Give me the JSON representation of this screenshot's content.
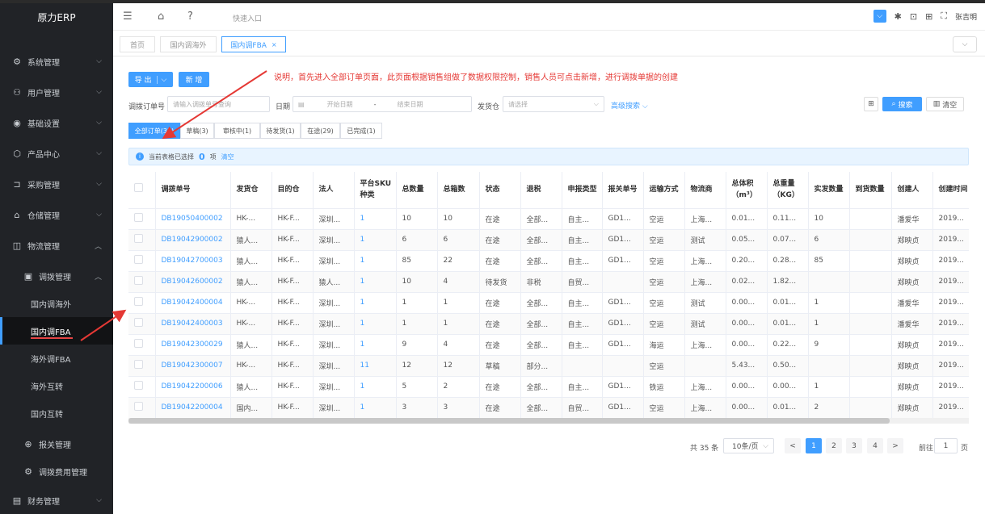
{
  "app": {
    "logo": "原力ERP"
  },
  "sidebar": {
    "items": [
      {
        "label": "系统管理",
        "icon": "gear-icon"
      },
      {
        "label": "用户管理",
        "icon": "user-icon"
      },
      {
        "label": "基础设置",
        "icon": "settings-icon"
      },
      {
        "label": "产品中心",
        "icon": "box-icon"
      },
      {
        "label": "采购管理",
        "icon": "cart-icon"
      },
      {
        "label": "仓储管理",
        "icon": "warehouse-icon"
      },
      {
        "label": "物流管理",
        "icon": "truck-icon"
      },
      {
        "label": "调拨管理",
        "icon": "transfer-icon"
      },
      {
        "label": "国内调海外"
      },
      {
        "label": "国内调FBA"
      },
      {
        "label": "海外调FBA"
      },
      {
        "label": "海外互转"
      },
      {
        "label": "国内互转"
      },
      {
        "label": "报关管理",
        "icon": "customs-icon"
      },
      {
        "label": "调拨费用管理",
        "icon": "fee-icon"
      },
      {
        "label": "财务管理",
        "icon": "finance-icon"
      }
    ]
  },
  "header": {
    "quick_entry": "快速入口",
    "user": "张吉明"
  },
  "tabs": [
    {
      "label": "首页"
    },
    {
      "label": "国内调海外"
    },
    {
      "label": "国内调FBA",
      "close": "×"
    }
  ],
  "toolbar": {
    "export": "导 出",
    "export_arrow": "⌵",
    "new": "新 增"
  },
  "note": "说明，首先进入全部订单页面，此页面根据销售组做了数据权限控制，销售人员可点击新增，进行调拨单据的创建",
  "filters": {
    "order_label": "调拨订单号",
    "order_placeholder": "请输入调拨单号查询",
    "date_label": "日期",
    "date_start": "开始日期",
    "date_sep": "-",
    "date_end": "结束日期",
    "warehouse_label": "发货仓",
    "warehouse_placeholder": "请选择",
    "advanced": "高级搜索",
    "search": "搜索",
    "clear": "清空"
  },
  "status_tabs": [
    {
      "label": "全部订单(35)"
    },
    {
      "label": "草稿(3)"
    },
    {
      "label": "审核中(1)"
    },
    {
      "label": "待发货(1)"
    },
    {
      "label": "在途(29)"
    },
    {
      "label": "已完成(1)"
    }
  ],
  "selection": {
    "prefix": "当前表格已选择",
    "count": "0",
    "unit": "项",
    "clear": "清空"
  },
  "table": {
    "columns": [
      "调拨单号",
      "发货仓",
      "目的仓",
      "法人",
      "平台SKU种类",
      "总数量",
      "总箱数",
      "状态",
      "退税",
      "申报类型",
      "报关单号",
      "运输方式",
      "物流商",
      "总体积（m³）",
      "总重量（KG）",
      "实发数量",
      "到货数量",
      "创建人",
      "创建时间"
    ],
    "rows": [
      [
        "DB19050400002",
        "HK-...",
        "HK-F...",
        "深圳...",
        "1",
        "10",
        "10",
        "在途",
        "全部...",
        "自主...",
        "GD1...",
        "空运",
        "上海...",
        "0.01...",
        "0.11...",
        "10",
        "",
        "潘爱华",
        "2019..."
      ],
      [
        "DB19042900002",
        "猿人...",
        "HK-F...",
        "深圳...",
        "1",
        "6",
        "6",
        "在途",
        "全部...",
        "自主...",
        "GD1...",
        "空运",
        "测试",
        "0.05...",
        "0.07...",
        "6",
        "",
        "郑映贞",
        "2019..."
      ],
      [
        "DB19042700003",
        "猿人...",
        "HK-F...",
        "深圳...",
        "1",
        "85",
        "22",
        "在途",
        "全部...",
        "自主...",
        "GD1...",
        "空运",
        "上海...",
        "0.20...",
        "0.28...",
        "85",
        "",
        "郑映贞",
        "2019..."
      ],
      [
        "DB19042600002",
        "猿人...",
        "HK-F...",
        "猿人...",
        "1",
        "10",
        "4",
        "待发货",
        "非税",
        "自贸...",
        "",
        "空运",
        "上海...",
        "0.02...",
        "1.82...",
        "",
        "",
        "郑映贞",
        "2019..."
      ],
      [
        "DB19042400004",
        "HK-...",
        "HK-F...",
        "深圳...",
        "1",
        "1",
        "1",
        "在途",
        "全部...",
        "自主...",
        "GD1...",
        "空运",
        "测试",
        "0.00...",
        "0.01...",
        "1",
        "",
        "潘爱华",
        "2019..."
      ],
      [
        "DB19042400003",
        "HK-...",
        "HK-F...",
        "深圳...",
        "1",
        "1",
        "1",
        "在途",
        "全部...",
        "自主...",
        "GD1...",
        "空运",
        "测试",
        "0.00...",
        "0.01...",
        "1",
        "",
        "潘爱华",
        "2019..."
      ],
      [
        "DB19042300029",
        "猿人...",
        "HK-F...",
        "深圳...",
        "1",
        "9",
        "4",
        "在途",
        "全部...",
        "自主...",
        "GD1...",
        "海运",
        "上海...",
        "0.00...",
        "0.22...",
        "9",
        "",
        "郑映贞",
        "2019..."
      ],
      [
        "DB19042300007",
        "HK-...",
        "HK-F...",
        "深圳...",
        "11",
        "12",
        "12",
        "草稿",
        "部分...",
        "",
        "",
        "空运",
        "",
        "5.43...",
        "0.50...",
        "",
        "",
        "郑映贞",
        "2019..."
      ],
      [
        "DB19042200006",
        "猿人...",
        "HK-F...",
        "深圳...",
        "1",
        "5",
        "2",
        "在途",
        "全部...",
        "自主...",
        "GD1...",
        "铁运",
        "上海...",
        "0.00...",
        "0.00...",
        "1",
        "",
        "郑映贞",
        "2019..."
      ],
      [
        "DB19042200004",
        "国内...",
        "HK-F...",
        "深圳...",
        "1",
        "3",
        "3",
        "在途",
        "全部...",
        "自贸...",
        "GD1...",
        "空运",
        "上海...",
        "0.00...",
        "0.01...",
        "2",
        "",
        "郑映贞",
        "2019..."
      ]
    ]
  },
  "pagination": {
    "total": "共 35 条",
    "page_size": "10条/页",
    "prev": "<",
    "pages": [
      "1",
      "2",
      "3",
      "4"
    ],
    "next": ">",
    "goto_label": "前往",
    "goto_value": "1",
    "goto_unit": "页"
  },
  "colors": {
    "accent": "#409eff",
    "sidebar_bg": "#212327",
    "note": "#e53935"
  }
}
